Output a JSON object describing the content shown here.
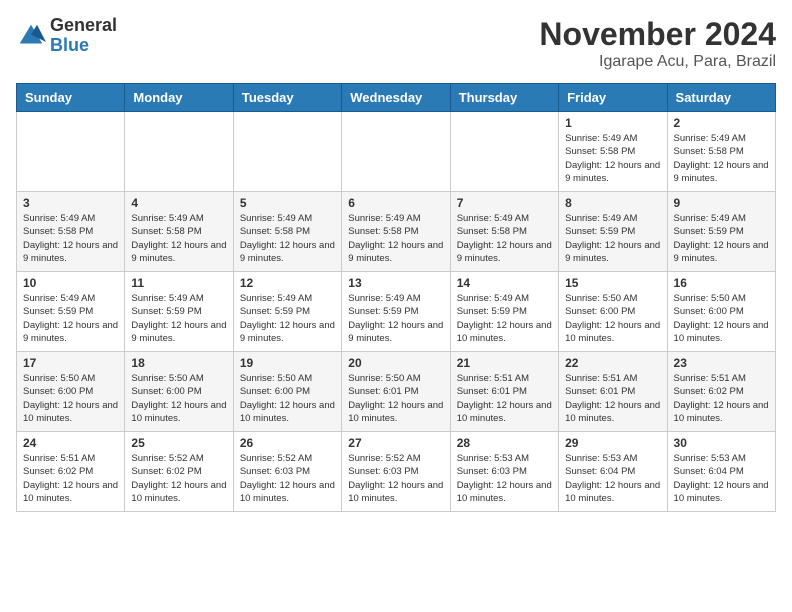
{
  "header": {
    "logo_general": "General",
    "logo_blue": "Blue",
    "title": "November 2024",
    "subtitle": "Igarape Acu, Para, Brazil"
  },
  "days_of_week": [
    "Sunday",
    "Monday",
    "Tuesday",
    "Wednesday",
    "Thursday",
    "Friday",
    "Saturday"
  ],
  "weeks": [
    [
      {
        "day": "",
        "info": ""
      },
      {
        "day": "",
        "info": ""
      },
      {
        "day": "",
        "info": ""
      },
      {
        "day": "",
        "info": ""
      },
      {
        "day": "",
        "info": ""
      },
      {
        "day": "1",
        "info": "Sunrise: 5:49 AM\nSunset: 5:58 PM\nDaylight: 12 hours and 9 minutes."
      },
      {
        "day": "2",
        "info": "Sunrise: 5:49 AM\nSunset: 5:58 PM\nDaylight: 12 hours and 9 minutes."
      }
    ],
    [
      {
        "day": "3",
        "info": "Sunrise: 5:49 AM\nSunset: 5:58 PM\nDaylight: 12 hours and 9 minutes."
      },
      {
        "day": "4",
        "info": "Sunrise: 5:49 AM\nSunset: 5:58 PM\nDaylight: 12 hours and 9 minutes."
      },
      {
        "day": "5",
        "info": "Sunrise: 5:49 AM\nSunset: 5:58 PM\nDaylight: 12 hours and 9 minutes."
      },
      {
        "day": "6",
        "info": "Sunrise: 5:49 AM\nSunset: 5:58 PM\nDaylight: 12 hours and 9 minutes."
      },
      {
        "day": "7",
        "info": "Sunrise: 5:49 AM\nSunset: 5:58 PM\nDaylight: 12 hours and 9 minutes."
      },
      {
        "day": "8",
        "info": "Sunrise: 5:49 AM\nSunset: 5:59 PM\nDaylight: 12 hours and 9 minutes."
      },
      {
        "day": "9",
        "info": "Sunrise: 5:49 AM\nSunset: 5:59 PM\nDaylight: 12 hours and 9 minutes."
      }
    ],
    [
      {
        "day": "10",
        "info": "Sunrise: 5:49 AM\nSunset: 5:59 PM\nDaylight: 12 hours and 9 minutes."
      },
      {
        "day": "11",
        "info": "Sunrise: 5:49 AM\nSunset: 5:59 PM\nDaylight: 12 hours and 9 minutes."
      },
      {
        "day": "12",
        "info": "Sunrise: 5:49 AM\nSunset: 5:59 PM\nDaylight: 12 hours and 9 minutes."
      },
      {
        "day": "13",
        "info": "Sunrise: 5:49 AM\nSunset: 5:59 PM\nDaylight: 12 hours and 9 minutes."
      },
      {
        "day": "14",
        "info": "Sunrise: 5:49 AM\nSunset: 5:59 PM\nDaylight: 12 hours and 10 minutes."
      },
      {
        "day": "15",
        "info": "Sunrise: 5:50 AM\nSunset: 6:00 PM\nDaylight: 12 hours and 10 minutes."
      },
      {
        "day": "16",
        "info": "Sunrise: 5:50 AM\nSunset: 6:00 PM\nDaylight: 12 hours and 10 minutes."
      }
    ],
    [
      {
        "day": "17",
        "info": "Sunrise: 5:50 AM\nSunset: 6:00 PM\nDaylight: 12 hours and 10 minutes."
      },
      {
        "day": "18",
        "info": "Sunrise: 5:50 AM\nSunset: 6:00 PM\nDaylight: 12 hours and 10 minutes."
      },
      {
        "day": "19",
        "info": "Sunrise: 5:50 AM\nSunset: 6:00 PM\nDaylight: 12 hours and 10 minutes."
      },
      {
        "day": "20",
        "info": "Sunrise: 5:50 AM\nSunset: 6:01 PM\nDaylight: 12 hours and 10 minutes."
      },
      {
        "day": "21",
        "info": "Sunrise: 5:51 AM\nSunset: 6:01 PM\nDaylight: 12 hours and 10 minutes."
      },
      {
        "day": "22",
        "info": "Sunrise: 5:51 AM\nSunset: 6:01 PM\nDaylight: 12 hours and 10 minutes."
      },
      {
        "day": "23",
        "info": "Sunrise: 5:51 AM\nSunset: 6:02 PM\nDaylight: 12 hours and 10 minutes."
      }
    ],
    [
      {
        "day": "24",
        "info": "Sunrise: 5:51 AM\nSunset: 6:02 PM\nDaylight: 12 hours and 10 minutes."
      },
      {
        "day": "25",
        "info": "Sunrise: 5:52 AM\nSunset: 6:02 PM\nDaylight: 12 hours and 10 minutes."
      },
      {
        "day": "26",
        "info": "Sunrise: 5:52 AM\nSunset: 6:03 PM\nDaylight: 12 hours and 10 minutes."
      },
      {
        "day": "27",
        "info": "Sunrise: 5:52 AM\nSunset: 6:03 PM\nDaylight: 12 hours and 10 minutes."
      },
      {
        "day": "28",
        "info": "Sunrise: 5:53 AM\nSunset: 6:03 PM\nDaylight: 12 hours and 10 minutes."
      },
      {
        "day": "29",
        "info": "Sunrise: 5:53 AM\nSunset: 6:04 PM\nDaylight: 12 hours and 10 minutes."
      },
      {
        "day": "30",
        "info": "Sunrise: 5:53 AM\nSunset: 6:04 PM\nDaylight: 12 hours and 10 minutes."
      }
    ]
  ]
}
